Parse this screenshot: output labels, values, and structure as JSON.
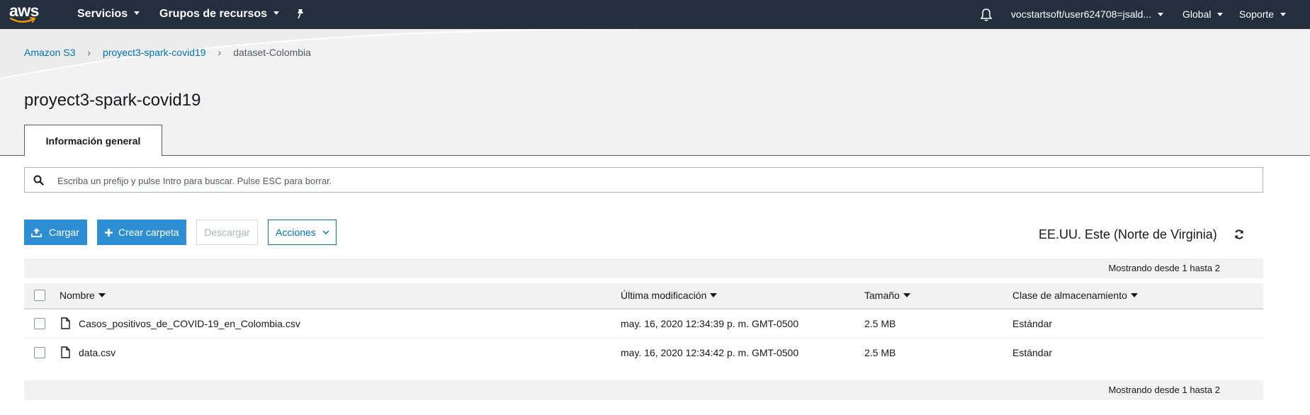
{
  "nav": {
    "logo": "aws",
    "services": "Servicios",
    "resource_groups": "Grupos de recursos",
    "account": "vocstartsoft/user624708=jsald...",
    "region_menu": "Global",
    "support": "Soporte",
    "icons": [
      "pin-icon",
      "bell-icon"
    ]
  },
  "breadcrumb": {
    "root": "Amazon S3",
    "bucket": "proyect3-spark-covid19",
    "folder": "dataset-Colombia"
  },
  "page_title": "proyect3-spark-covid19",
  "tabs": {
    "overview": "Información general"
  },
  "search": {
    "placeholder": "Escriba un prefijo y pulse Intro para buscar. Pulse ESC para borrar."
  },
  "toolbar": {
    "upload": "Cargar",
    "create_folder": "Crear carpeta",
    "download": "Descargar",
    "actions": "Acciones",
    "region": "EE.UU. Este (Norte de Virginia)"
  },
  "table": {
    "showing_top": "Mostrando desde 1 hasta 2",
    "showing_bottom": "Mostrando desde 1 hasta 2",
    "columns": {
      "name": "Nombre",
      "modified": "Última modificación",
      "size": "Tamaño",
      "storage_class": "Clase de almacenamiento"
    },
    "rows": [
      {
        "name": "Casos_positivos_de_COVID-19_en_Colombia.csv",
        "modified": "may. 16, 2020 12:34:39 p. m. GMT-0500",
        "size": "2.5 MB",
        "storage_class": "Estándar"
      },
      {
        "name": "data.csv",
        "modified": "may. 16, 2020 12:34:42 p. m. GMT-0500",
        "size": "2.5 MB",
        "storage_class": "Estándar"
      }
    ]
  },
  "colors": {
    "nav_bg": "#232f3e",
    "primary_button": "#2e8ed4",
    "link": "#0073bb",
    "aws_smile": "#ff9900"
  }
}
